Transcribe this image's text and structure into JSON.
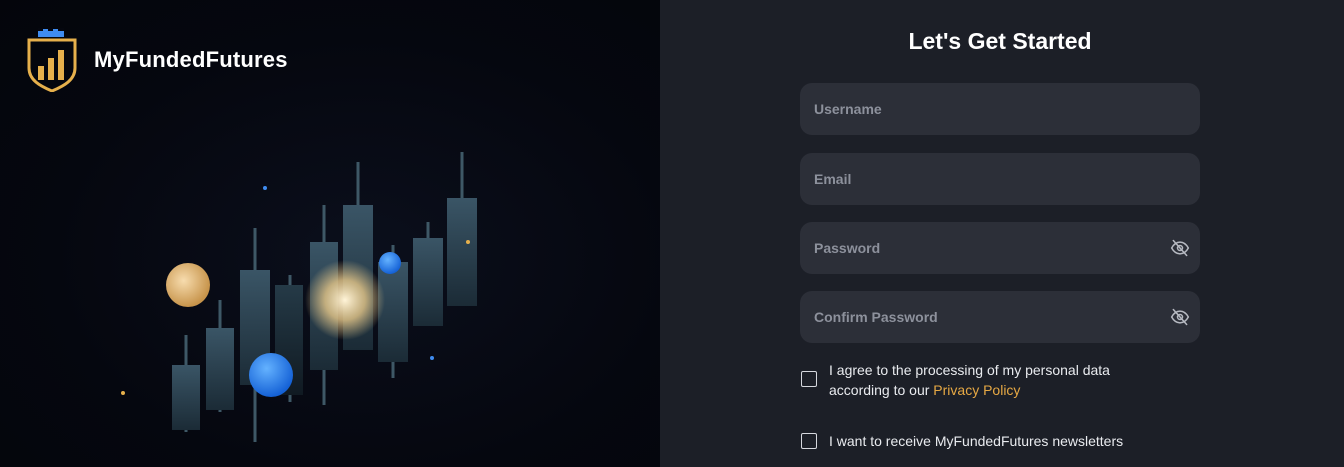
{
  "brand": {
    "name": "MyFundedFutures",
    "logo_icon": "shield-chart-icon"
  },
  "form": {
    "title": "Let's Get Started",
    "username_placeholder": "Username",
    "email_placeholder": "Email",
    "password_placeholder": "Password",
    "confirm_placeholder": "Confirm Password",
    "password_toggle_icon": "eye-off-icon"
  },
  "consent": {
    "line1": "I agree to the processing of my personal data",
    "line2_prefix": "according to our ",
    "privacy_link": "Privacy Policy",
    "newsletter": "I want to receive MyFundedFutures newsletters"
  },
  "colors": {
    "accent": "#e6a844",
    "field_bg": "#2c2f38",
    "panel_bg": "#1c1f27"
  }
}
